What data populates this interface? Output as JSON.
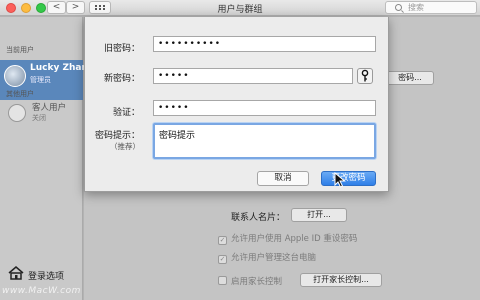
{
  "window": {
    "title": "用户与群组",
    "search_placeholder": "搜索",
    "nav_back": "<",
    "nav_forward": ">"
  },
  "sidebar": {
    "current_users_header": "当前用户",
    "current_user": {
      "name": "Lucky Zhan",
      "role": "管理员"
    },
    "other_users_header": "其他用户",
    "guest_user": {
      "name": "客人用户",
      "status": "关闭"
    },
    "login_options": "登录选项"
  },
  "dialog": {
    "old_password_label": "旧密码：",
    "old_password_value": "••••••••••",
    "new_password_label": "新密码：",
    "new_password_value": "•••••",
    "verify_label": "验证：",
    "verify_value": "•••••",
    "hint_label": "密码提示：",
    "hint_sub": "（推荐）",
    "hint_value": "密码提示",
    "cancel": "取消",
    "change": "更改密码"
  },
  "background": {
    "password_button_fragment": "密码...",
    "contact_card_label": "联系人名片：",
    "open_button": "打开...",
    "checkboxes": [
      {
        "label": "允许用户使用 Apple ID 重设密码",
        "checked": true
      },
      {
        "label": "允许用户管理这台电脑",
        "checked": true
      },
      {
        "label": "启用家长控制",
        "checked": false
      }
    ],
    "parental_button": "打开家长控制..."
  },
  "watermark": "www.MacW.com",
  "colors": {
    "accent": "#2f7fe8",
    "selection": "#5a87bb"
  }
}
